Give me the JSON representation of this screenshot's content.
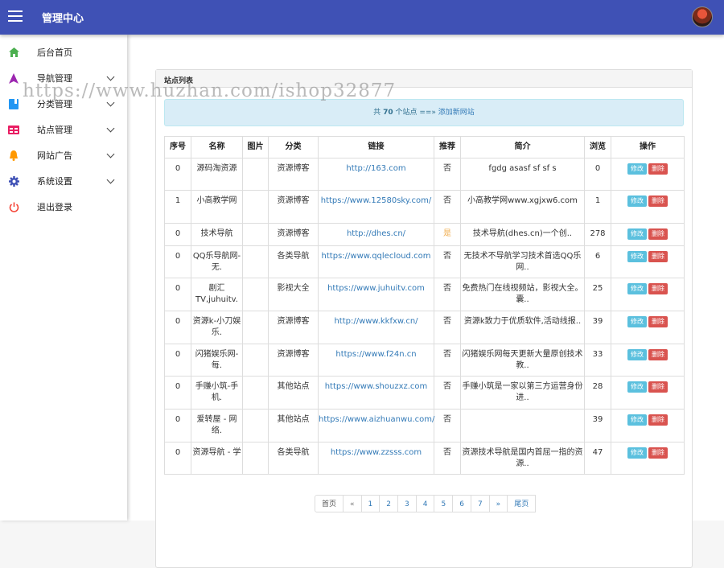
{
  "header": {
    "title": "管理中心"
  },
  "sidebar": {
    "items": [
      {
        "label": "后台首页",
        "icon": "home-icon",
        "color": "#4caf50",
        "expandable": false
      },
      {
        "label": "导航管理",
        "icon": "navigation-icon",
        "color": "#9c27b0",
        "expandable": true
      },
      {
        "label": "分类管理",
        "icon": "book-icon",
        "color": "#2196f3",
        "expandable": true
      },
      {
        "label": "站点管理",
        "icon": "site-table-icon",
        "color": "#e91e63",
        "expandable": true
      },
      {
        "label": "网站广告",
        "icon": "bell-icon",
        "color": "#ff9800",
        "expandable": true
      },
      {
        "label": "系统设置",
        "icon": "gear-icon",
        "color": "#3f51b5",
        "expandable": true
      },
      {
        "label": "退出登录",
        "icon": "power-icon",
        "color": "#f44336",
        "expandable": false
      }
    ]
  },
  "watermark": "https://www.huzhan.com/ishop32877",
  "panel": {
    "title": "站点列表",
    "info_prefix": "共",
    "total": "70",
    "info_middle": "个站点 ==»",
    "add_link": "添加新网站"
  },
  "table": {
    "headers": [
      "序号",
      "名称",
      "图片",
      "分类",
      "链接",
      "推荐",
      "简介",
      "浏览",
      "操作"
    ],
    "edit_label": "修改",
    "delete_label": "删除",
    "rows": [
      {
        "id": "0",
        "name": "源码淘资源",
        "image": "",
        "category": "资源博客",
        "url": "http://163.com",
        "recommend": "否",
        "intro": "fgdg asasf sf sf s",
        "views": "0"
      },
      {
        "id": "1",
        "name": "小高教学网",
        "image": "",
        "category": "资源博客",
        "url": "https://www.12580sky.com/",
        "recommend": "否",
        "intro": "小高教学网www.xgjxw6.com",
        "views": "1"
      },
      {
        "id": "0",
        "name": "技术导航",
        "image": "",
        "category": "资源博客",
        "url": "http://dhes.cn/",
        "recommend": "是",
        "intro": "技术导航(dhes.cn)一个创..",
        "views": "278"
      },
      {
        "id": "0",
        "name": "QQ乐导航网-无.",
        "image": "",
        "category": "各类导航",
        "url": "https://www.qqlecloud.com",
        "recommend": "否",
        "intro": "无技术不导航学习技术首选QQ乐网..",
        "views": "6"
      },
      {
        "id": "0",
        "name": "剧汇TV,juhuitv.",
        "image": "",
        "category": "影视大全",
        "url": "https://www.juhuitv.com",
        "recommend": "否",
        "intro": "免费热门在线视频站，影视大全。囊..",
        "views": "25"
      },
      {
        "id": "0",
        "name": "资源k-小刀娱乐.",
        "image": "",
        "category": "资源博客",
        "url": "http://www.kkfxw.cn/",
        "recommend": "否",
        "intro": "资源k致力于优质软件,活动线报..",
        "views": "39"
      },
      {
        "id": "0",
        "name": "闪猪娱乐网-每.",
        "image": "",
        "category": "资源博客",
        "url": "https://www.f24n.cn",
        "recommend": "否",
        "intro": "闪猪娱乐网每天更新大量原创技术教..",
        "views": "33"
      },
      {
        "id": "0",
        "name": "手赚小筑-手机.",
        "image": "",
        "category": "其他站点",
        "url": "https://www.shouzxz.com",
        "recommend": "否",
        "intro": "手赚小筑是一家以第三方运营身份进..",
        "views": "28"
      },
      {
        "id": "0",
        "name": "爱转屋 - 网络.",
        "image": "",
        "category": "其他站点",
        "url": "https://www.aizhuanwu.com/",
        "recommend": "否",
        "intro": "",
        "views": "39"
      },
      {
        "id": "0",
        "name": "资源导航 - 学",
        "image": "",
        "category": "各类导航",
        "url": "https://www.zzsss.com",
        "recommend": "否",
        "intro": "资源技术导航是国内首屈一指的资源..",
        "views": "47"
      }
    ]
  },
  "pagination": {
    "first": "首页",
    "prev": "«",
    "pages": [
      "1",
      "2",
      "3",
      "4",
      "5",
      "6",
      "7"
    ],
    "next": "»",
    "last": "尾页"
  }
}
